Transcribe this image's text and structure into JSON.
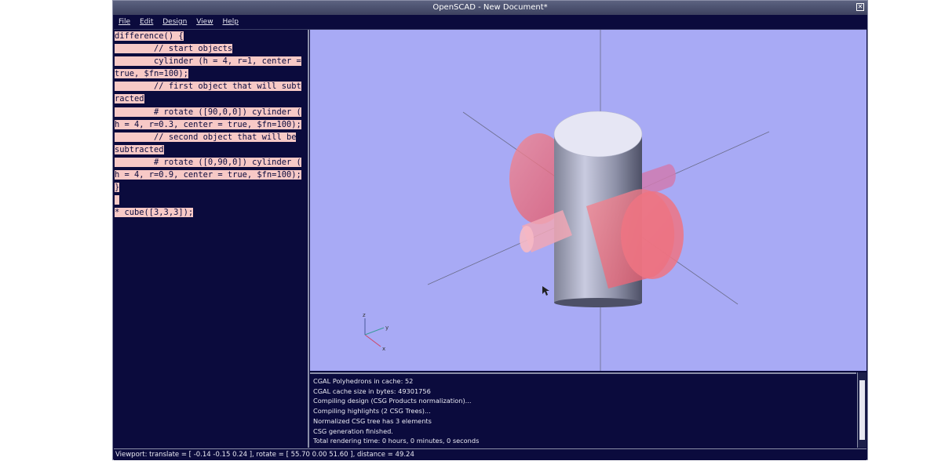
{
  "window": {
    "title": "OpenSCAD - New Document*",
    "close_symbol": "✕"
  },
  "menu": {
    "items": [
      "File",
      "Edit",
      "Design",
      "View",
      "Help"
    ]
  },
  "editor": {
    "lines": [
      {
        "text": "difference() {",
        "highlight": true
      },
      {
        "text": "        // start objects",
        "highlight": true
      },
      {
        "text": "        cylinder (h = 4, r=1, center =",
        "highlight": true
      },
      {
        "text": "true, $fn=100);",
        "highlight": true
      },
      {
        "text": "        // first object that will subt",
        "highlight": true
      },
      {
        "text": "racted",
        "highlight": true
      },
      {
        "text": "        # rotate ([90,0,0]) cylinder (",
        "highlight": true
      },
      {
        "text": "h = 4, r=0.3, center = true, $fn=100);",
        "highlight": true
      },
      {
        "text": "        // second object that will be",
        "highlight": true
      },
      {
        "text": "subtracted",
        "highlight": true
      },
      {
        "text": "        # rotate ([0,90,0]) cylinder (",
        "highlight": true
      },
      {
        "text": "h = 4, r=0.9, center = true, $fn=100);",
        "highlight": true
      },
      {
        "text": "}",
        "highlight": true
      },
      {
        "text": " ",
        "highlight": true
      },
      {
        "text": "* cube([3,3,3]);",
        "highlight": true
      }
    ]
  },
  "viewport": {
    "background": "#a8aaf5",
    "axis_labels": {
      "z": "z",
      "y": "y",
      "x": "x"
    }
  },
  "console": {
    "lines": [
      "CGAL Polyhedrons in cache: 52",
      "CGAL cache size in bytes: 49301756",
      "Compiling design (CSG Products normalization)...",
      "Compiling highlights (2 CSG Trees)...",
      "Normalized CSG tree has 3 elements",
      "CSG generation finished.",
      "Total rendering time: 0 hours, 0 minutes, 0 seconds"
    ]
  },
  "status": {
    "text": "Viewport: translate = [ -0.14 -0.15 0.24 ], rotate = [ 55.70 0.00 51.60 ], distance = 49.24"
  }
}
